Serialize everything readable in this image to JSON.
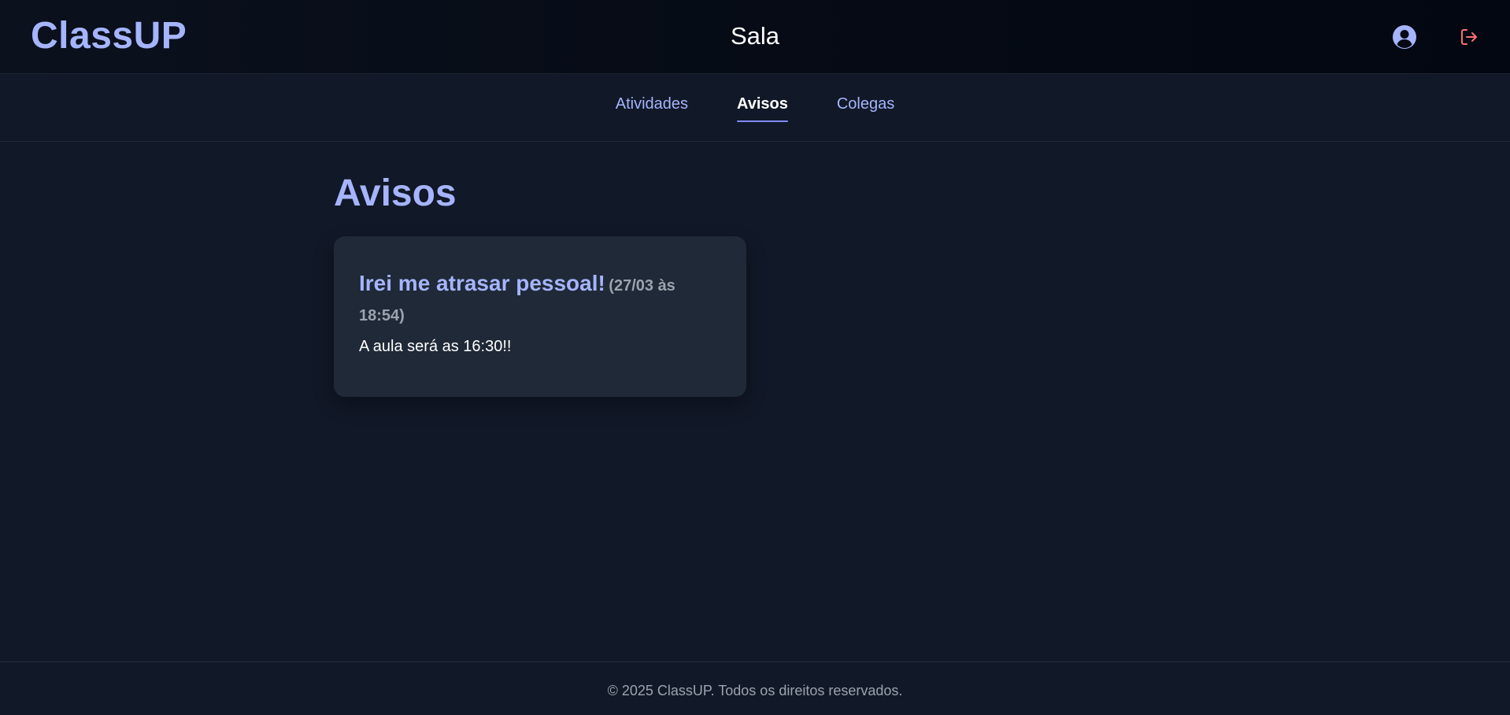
{
  "header": {
    "brand": "ClassUP",
    "title": "Sala",
    "profile_icon": "user-circle-icon",
    "logout_icon": "logout-icon",
    "logout_color": "#f87171"
  },
  "tabs": [
    {
      "label": "Atividades",
      "active": false
    },
    {
      "label": "Avisos",
      "active": true
    },
    {
      "label": "Colegas",
      "active": false
    }
  ],
  "main": {
    "section_title": "Avisos",
    "notices": [
      {
        "title": "Irei me atrasar pessoal!",
        "date": "(27/03 às 18:54)",
        "body": "A aula será as 16:30!!"
      }
    ]
  },
  "footer": {
    "text": "© 2025 ClassUP. Todos os direitos reservados."
  },
  "colors": {
    "accent": "#a5b4fc",
    "background": "#111827",
    "card": "#1f2937"
  }
}
